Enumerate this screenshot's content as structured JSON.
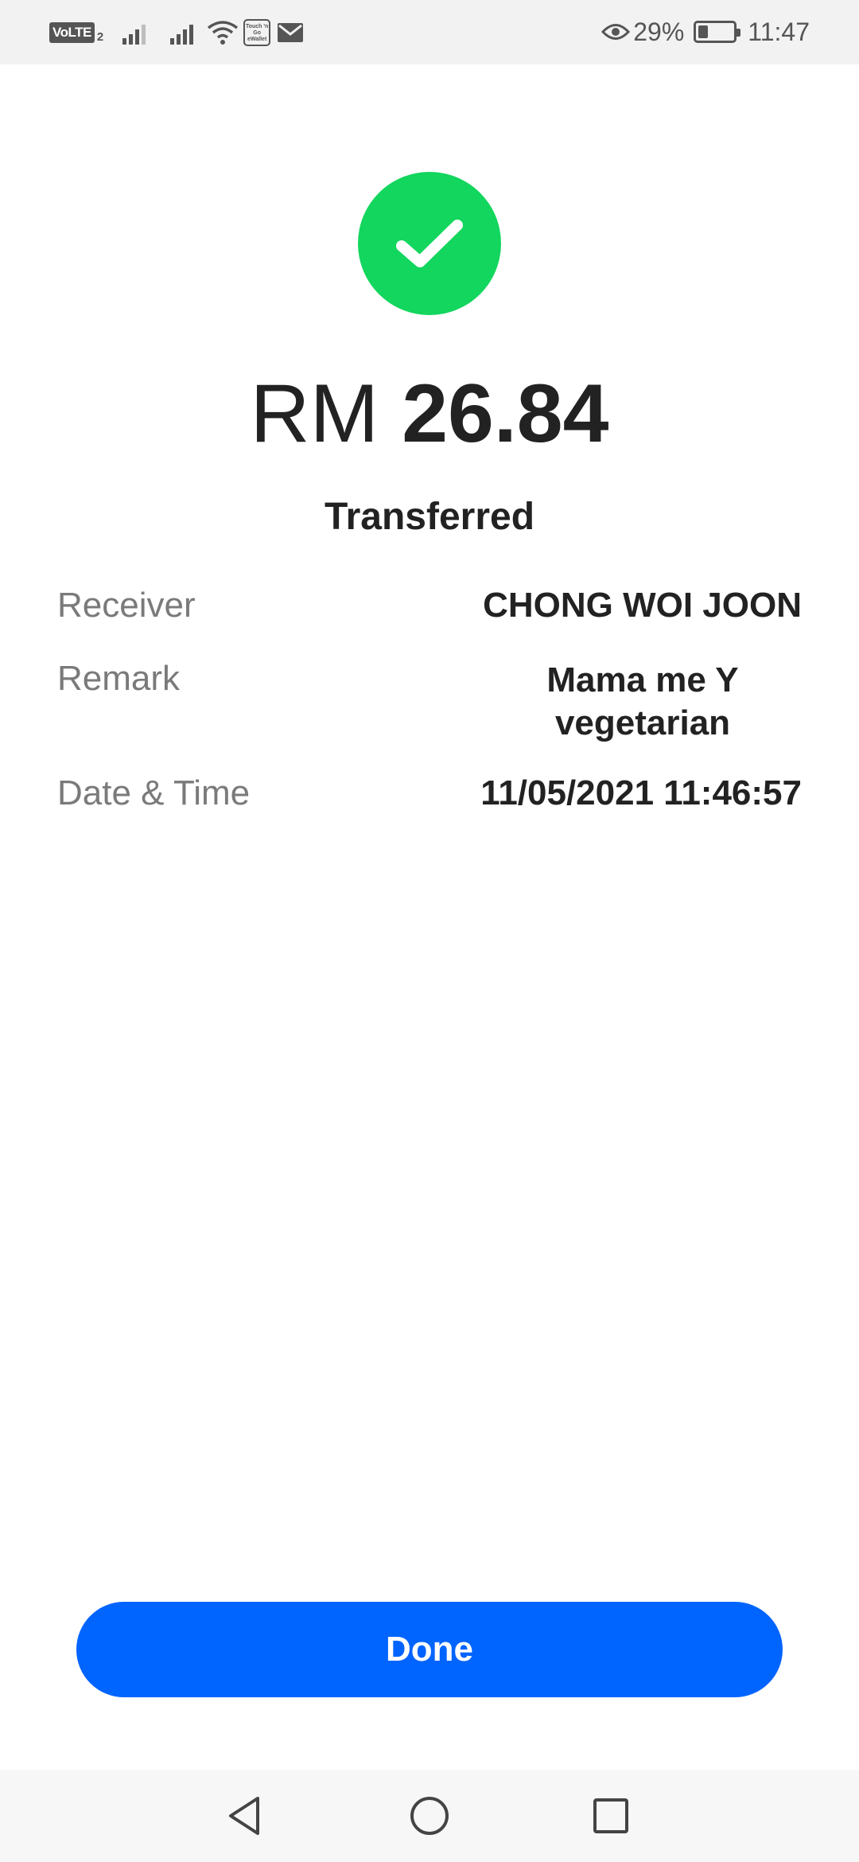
{
  "status_bar": {
    "network_label": "VoLTE",
    "sim_slot": "2",
    "tng_label": "Touch 'n Go eWallet",
    "battery_percent_text": "29%",
    "battery_level": 0.29,
    "time": "11:47",
    "icons": [
      "volte-icon",
      "signal-icon",
      "signal-icon",
      "wifi-icon",
      "tng-icon",
      "mail-icon",
      "eye-icon",
      "battery-icon"
    ]
  },
  "result": {
    "currency": "RM",
    "amount": "26.84",
    "status": "Transferred",
    "icon": "check-icon",
    "accent_color": "#12d65d"
  },
  "details": {
    "receiver_label": "Receiver",
    "receiver_value": "CHONG WOI JOON",
    "remark_label": "Remark",
    "remark_value": "Mama me Y vegetarian",
    "datetime_label": "Date & Time",
    "datetime_value": "11/05/2021 11:46:57"
  },
  "actions": {
    "done_label": "Done",
    "done_color": "#0064ff"
  },
  "nav_bar": {
    "icons": [
      "back-icon",
      "home-icon",
      "recent-apps-icon"
    ]
  }
}
